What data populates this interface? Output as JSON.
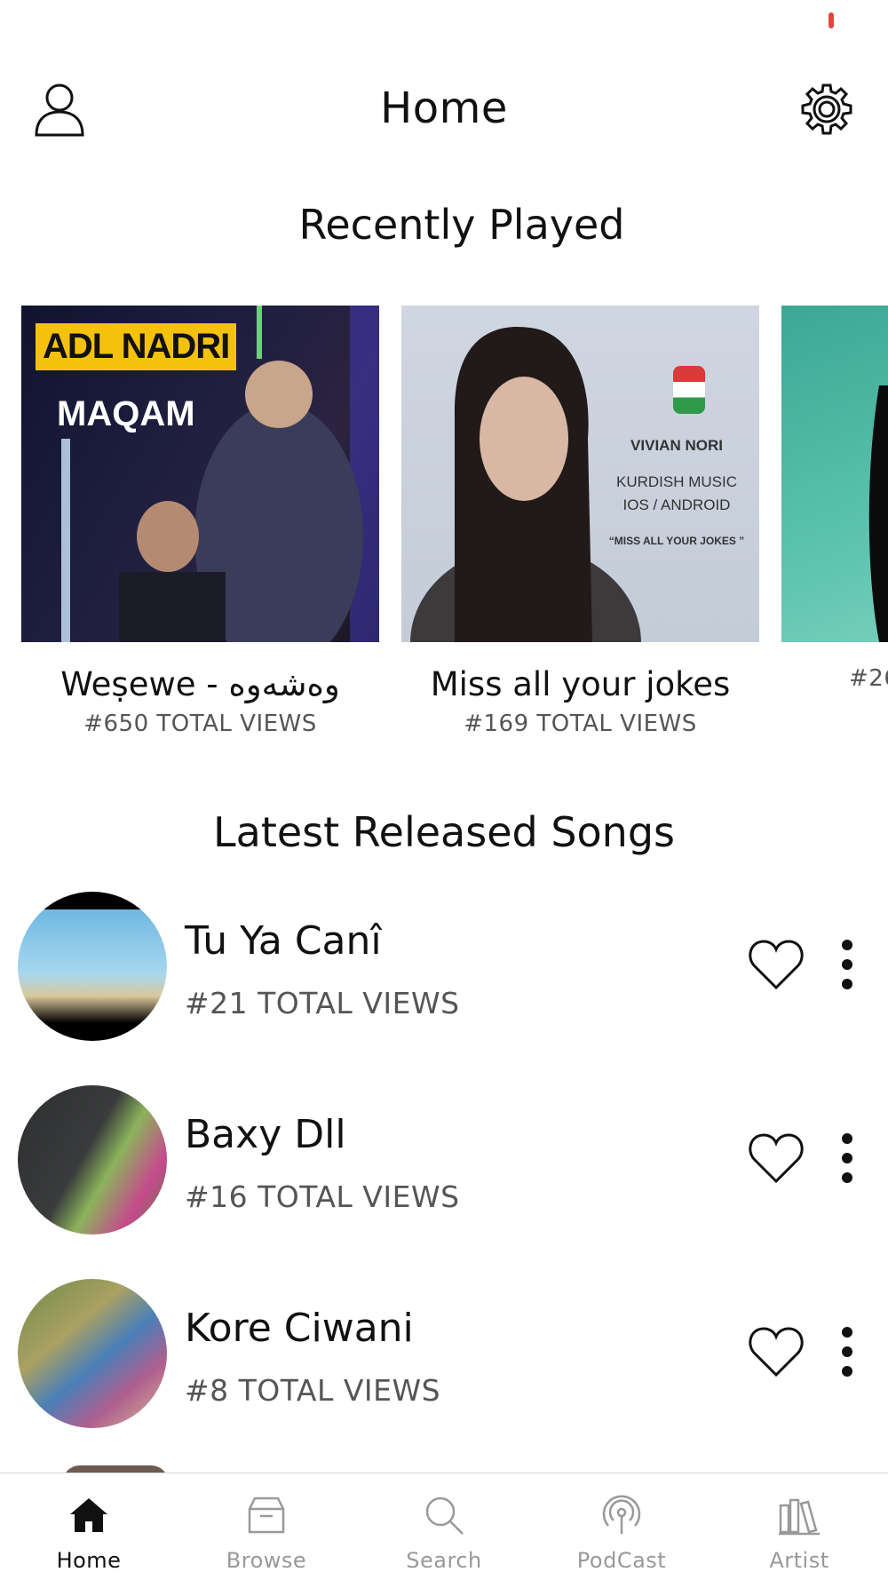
{
  "header": {
    "title": "Home"
  },
  "recently_played": {
    "title": "Recently Played",
    "items": [
      {
        "name": "Weṣewe - وەشەوە",
        "views": "#650 TOTAL VIEWS",
        "art_tag": "ADL NADRI",
        "art_sub": "MAQAM"
      },
      {
        "name": "Miss all your jokes",
        "views": "#169 TOTAL VIEWS",
        "art_artist": "VIVIAN NORI",
        "art_line1": "KURDISH MUSIC",
        "art_line2": "IOS / ANDROID",
        "art_quote": "“MISS ALL YOUR JOKES ”"
      },
      {
        "name": "",
        "views": "#26"
      }
    ]
  },
  "latest": {
    "title": "Latest Released Songs",
    "songs": [
      {
        "title": "Tu Ya Canî",
        "views": "#21 TOTAL VIEWS"
      },
      {
        "title": "Baxy Dll",
        "views": "#16 TOTAL VIEWS"
      },
      {
        "title": "Kore Ciwani",
        "views": "#8 TOTAL VIEWS"
      }
    ]
  },
  "nav": {
    "items": [
      {
        "label": "Home",
        "icon": "home-icon",
        "active": true
      },
      {
        "label": "Browse",
        "icon": "browse-icon"
      },
      {
        "label": "Search",
        "icon": "search-icon"
      },
      {
        "label": "PodCast",
        "icon": "podcast-icon"
      },
      {
        "label": "Artist",
        "icon": "artist-icon"
      }
    ]
  },
  "colors": {
    "status_indicator": "#e5463c",
    "tag_yellow": "#f4c20d",
    "inactive_nav": "#999999"
  }
}
